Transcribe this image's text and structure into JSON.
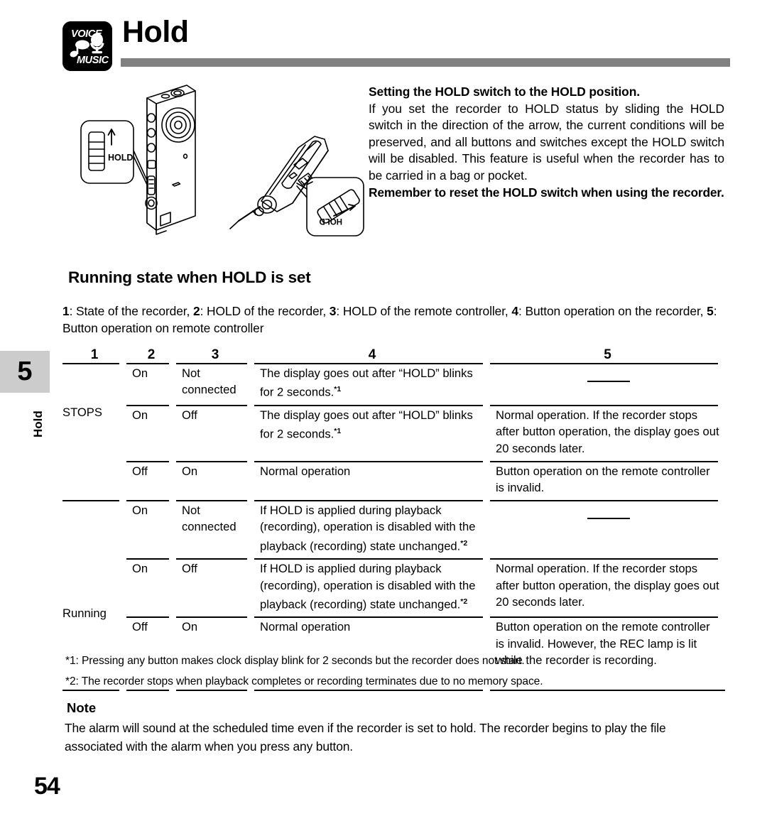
{
  "header": {
    "badge_icon": "voice-music-badge-icon",
    "badge_top_text": "VOICE",
    "badge_bottom_text": "MUSIC",
    "title": "Hold",
    "rule_color": "#808080"
  },
  "illustration": {
    "recorder_callout_label": "HOLD",
    "remote_callout_label": "HOLD",
    "alt": "Voice recorder and remote controller showing the HOLD switch direction"
  },
  "intro": {
    "lead_before": "Setting the ",
    "lead_hold": "HOLD",
    "lead_after": " switch to the HOLD position.",
    "body": "If you set the recorder to HOLD status by sliding the HOLD switch in the direction of the arrow, the current conditions will be preserved, and all buttons and switches except the HOLD switch will be disabled. This feature is useful when the recorder has to be carried in a bag or pocket.",
    "tail": "Remember to reset the HOLD switch when using the recorder."
  },
  "section": {
    "heading": "Running state when HOLD is set",
    "legend_parts": [
      {
        "num": "1",
        "text": ": State of the recorder, "
      },
      {
        "num": "2",
        "text": ": HOLD of the recorder, "
      },
      {
        "num": "3",
        "text": ": HOLD of the remote controller, "
      },
      {
        "num": "4",
        "text": ": Button operation on the recorder, "
      },
      {
        "num": "5",
        "text": ": Button operation on remote controller"
      }
    ]
  },
  "chapter_tab": {
    "number": "5",
    "name": "Hold",
    "background": "#cccccc"
  },
  "table": {
    "headers": [
      "1",
      "2",
      "3",
      "4",
      "5"
    ],
    "groups": [
      {
        "label": "STOPS",
        "rows": [
          {
            "col2": "On",
            "col3": "Not connected",
            "col4": "The display goes out after “HOLD” blinks for 2 seconds.",
            "col4_fn": "*1",
            "col5": "",
            "col5_dash": true
          },
          {
            "col2": "On",
            "col3": "Off",
            "col4": "The display goes out after “HOLD” blinks for 2 seconds.",
            "col4_fn": "*1",
            "col5": "Normal operation. If the recorder stops after button operation, the display goes out 20 seconds later.",
            "col5_dash": false
          },
          {
            "col2": "Off",
            "col3": "On",
            "col4": "Normal operation",
            "col4_fn": "",
            "col5": "Button operation on the remote controller is invalid.",
            "col5_dash": false
          }
        ]
      },
      {
        "label": "Running",
        "rows": [
          {
            "col2": "On",
            "col3": "Not connected",
            "col4": "If HOLD is applied during playback (recording), operation is disabled with the playback (recording) state unchanged.",
            "col4_fn": "*2",
            "col5": "",
            "col5_dash": true
          },
          {
            "col2": "On",
            "col3": "Off",
            "col4": "If HOLD is applied during playback (recording), operation is disabled with the playback (recording) state unchanged.",
            "col4_fn": "*2",
            "col5": "Normal operation. If the recorder stops after button operation, the display goes out 20 seconds later.",
            "col5_dash": false
          },
          {
            "col2": "Off",
            "col3": "On",
            "col4": "Normal operation",
            "col4_fn": "",
            "col5": "Button operation on the remote controller is invalid. However, the REC lamp is lit while the recorder is recording.",
            "col5_dash": false
          }
        ]
      }
    ]
  },
  "footnotes": [
    "*1: Pressing any button makes clock display blink for 2 seconds but the recorder does not start.",
    "*2: The recorder stops when playback completes or recording terminates due to no memory space."
  ],
  "note": {
    "heading": "Note",
    "body": "The alarm will sound at the scheduled time even if the recorder is set to hold. The recorder begins to play the file associated with the alarm when you press any button."
  },
  "folio": {
    "page_number": "54"
  }
}
